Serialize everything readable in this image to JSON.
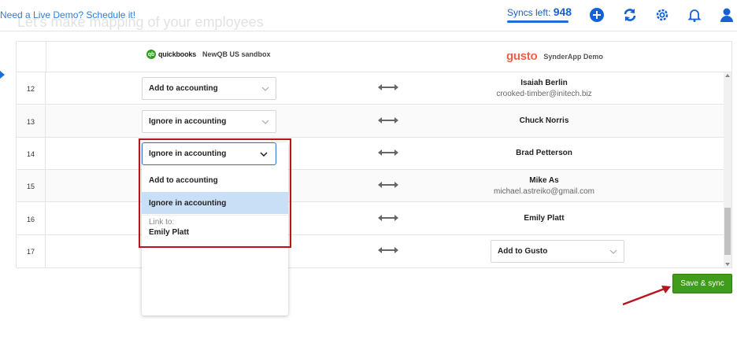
{
  "topbar": {
    "demo_link": "Need a Live Demo? Schedule it!",
    "ghost_title": "Let's make mapping of your employees",
    "syncs_label": "Syncs left:",
    "syncs_count": "948",
    "icons": [
      "plus-circle-icon",
      "refresh-icon",
      "gear-icon",
      "bell-icon",
      "user-icon"
    ],
    "accent_color": "#1662d4"
  },
  "header": {
    "left_brand": "quickbooks",
    "left_brand_badge": "qb",
    "left_company": "NewQB US sandbox",
    "right_brand": "gusto",
    "right_company": "SynderApp Demo"
  },
  "rows": [
    {
      "num": "12",
      "select": "Add to accounting",
      "emp_name": "Isaiah Berlin",
      "emp_email": "crooked-timber@initech.biz"
    },
    {
      "num": "13",
      "select": "Ignore in accounting",
      "emp_name": "Chuck Norris",
      "emp_email": ""
    },
    {
      "num": "14",
      "select": "",
      "emp_name": "Brad Petterson",
      "emp_email": ""
    },
    {
      "num": "15",
      "select": "",
      "emp_name": "Mike As",
      "emp_email": "michael.astreiko@gmail.com"
    },
    {
      "num": "16",
      "select": "",
      "emp_name": "Emily Platt",
      "emp_email": ""
    },
    {
      "num": "17",
      "select": "",
      "emp_name": "",
      "emp_email": "",
      "gusto_select": "Add to Gusto"
    }
  ],
  "dropdown": {
    "selected": "Ignore in accounting",
    "options": [
      "Add to accounting",
      "Ignore in accounting"
    ],
    "link_label": "Link to:",
    "link_name": "Emily Platt",
    "highlight_color": "#c9dff6"
  },
  "save_button": "Save & sync",
  "colors": {
    "save": "#3f9d1a",
    "annotation": "#b8141c",
    "gusto": "#f45d48",
    "quickbooks": "#2ca01c"
  }
}
